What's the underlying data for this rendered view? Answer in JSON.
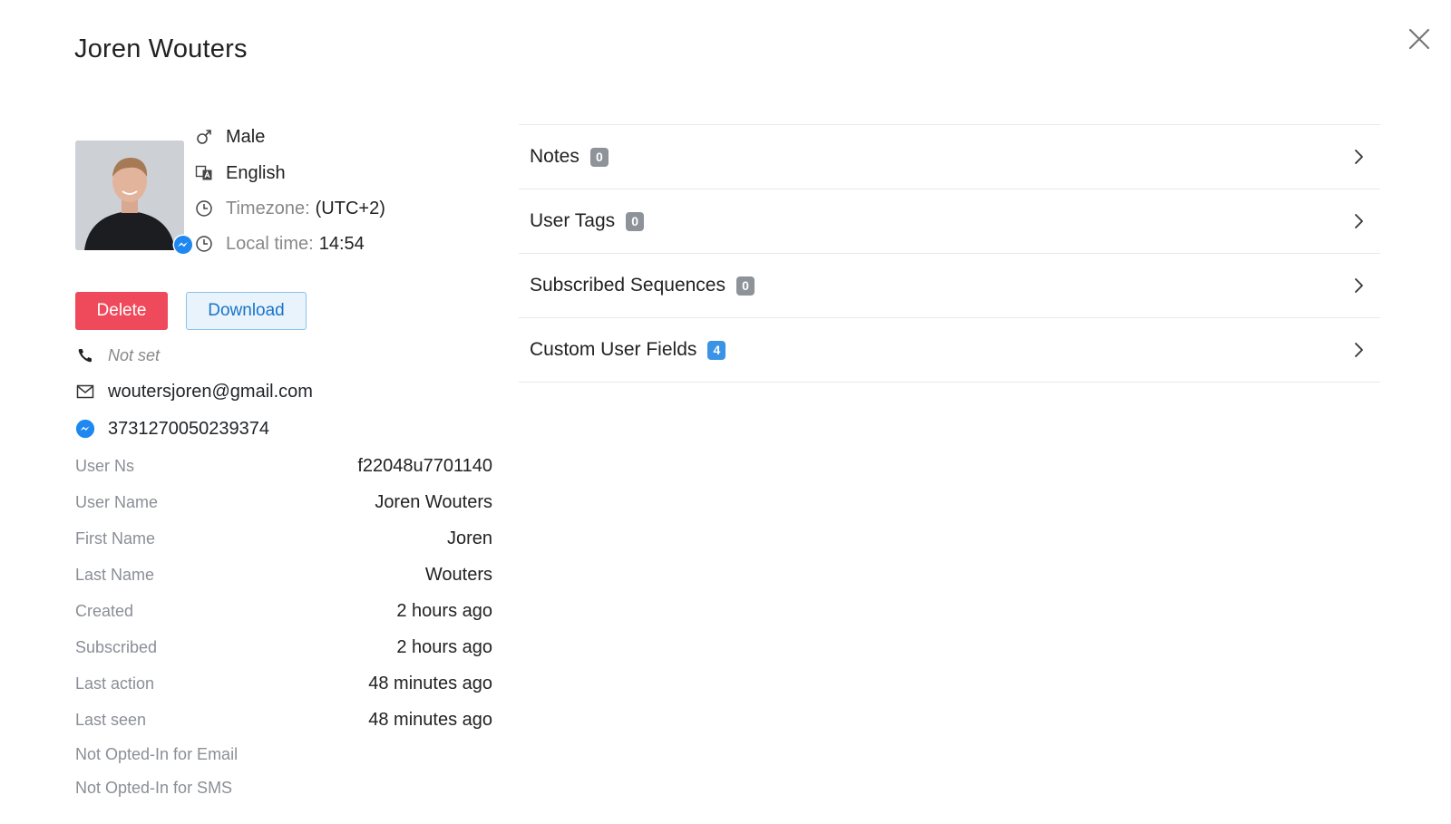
{
  "page": {
    "title": "Joren Wouters"
  },
  "profile": {
    "gender": "Male",
    "language": "English",
    "timezone_label": "Timezone:",
    "timezone_value": "(UTC+2)",
    "localtime_label": "Local time:",
    "localtime_value": "14:54"
  },
  "actions": {
    "delete_label": "Delete",
    "download_label": "Download"
  },
  "contact": {
    "phone": "Not set",
    "email": "woutersjoren@gmail.com",
    "messenger_id": "3731270050239374"
  },
  "fields": [
    {
      "label": "User Ns",
      "value": "f22048u7701140"
    },
    {
      "label": "User Name",
      "value": "Joren Wouters"
    },
    {
      "label": "First Name",
      "value": "Joren"
    },
    {
      "label": "Last Name",
      "value": "Wouters"
    },
    {
      "label": "Created",
      "value": "2 hours ago"
    },
    {
      "label": "Subscribed",
      "value": "2 hours ago"
    },
    {
      "label": "Last action",
      "value": "48 minutes ago"
    },
    {
      "label": "Last seen",
      "value": "48 minutes ago"
    }
  ],
  "optin": {
    "email": "Not Opted-In for Email",
    "sms": "Not Opted-In for SMS"
  },
  "sections": [
    {
      "title": "Notes",
      "count": "0"
    },
    {
      "title": "User Tags",
      "count": "0"
    },
    {
      "title": "Subscribed Sequences",
      "count": "0"
    },
    {
      "title": "Custom User Fields",
      "count": "4"
    }
  ],
  "colors": {
    "delete_bg": "#ef4a5c",
    "download_text": "#1a74c8",
    "badge_grey": "#8d9399",
    "badge_blue": "#3b93e6",
    "messenger_blue": "#1e88f0"
  }
}
